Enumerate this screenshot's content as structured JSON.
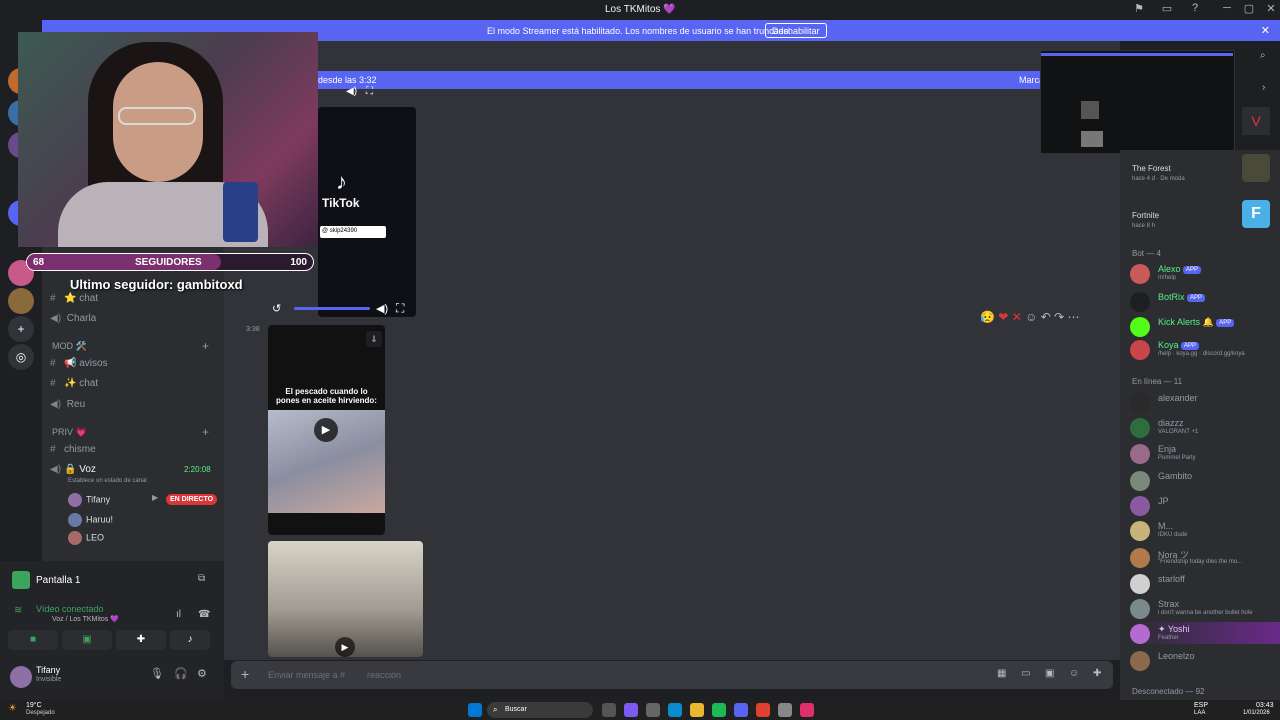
{
  "window": {
    "title": "Los TKMitos 💜"
  },
  "banner": {
    "text": "El modo Streamer está habilitado. Los nombres de usuario se han truncado.",
    "button": "Deshabilitar"
  },
  "stream_overlay": {
    "followers_current": "68",
    "followers_label": "SEGUIDORES",
    "followers_goal": "100",
    "followers_progress": 0.68,
    "last_follower": "Ultimo seguidor: gambitoxd"
  },
  "channels": {
    "items": [
      {
        "label": "chat"
      },
      {
        "label": "Charla"
      }
    ],
    "mod_category": "MOD 🛠️",
    "mod_items": [
      {
        "label": "avisos"
      },
      {
        "label": "chat"
      },
      {
        "label": "Reu"
      }
    ],
    "priv_category": "PRIV 💗",
    "priv_items": [
      {
        "label": "chisme"
      }
    ],
    "voice_channel": "Voz",
    "voice_timer": "2:20:08",
    "voice_status_hint": "Establece un estado de canal",
    "voice_users": [
      {
        "name": "Tifany"
      },
      {
        "name": "Haruu!"
      },
      {
        "name": "LEO"
      }
    ],
    "live_badge": "EN DIRECTO"
  },
  "voice_panel": {
    "screen_title": "Pantalla 1",
    "connected_label": "Vídeo conectado",
    "connected_sub": "Voz / Los TKMitos 💜",
    "user_name": "Tifany",
    "user_status": "Invisible"
  },
  "chat": {
    "new_messages": "desde las 3:32",
    "mark_read": "Marca",
    "timestamp": "3:38",
    "tiktok_brand": "TikTok",
    "tiktok_handle": "@ skip24390",
    "video_caption": "El pescado cuando lo pones en aceite hirviendo:",
    "composer_placeholder": "Enviar mensaje a #",
    "composer_suffix": "reacción"
  },
  "members": {
    "activity": [
      {
        "name": "The Forest",
        "sub": "hace 4 d · De moda"
      },
      {
        "name": "Fortnite",
        "sub": "hace 8 h"
      }
    ],
    "bot_header": "Bot — 4",
    "bots": [
      {
        "name": "Alexo",
        "sub": "m!help",
        "color": "#57f287"
      },
      {
        "name": "BotRix",
        "sub": "",
        "color": "#57f287"
      },
      {
        "name": "Kick Alerts",
        "sub": "",
        "color": "#57f287"
      },
      {
        "name": "Koya",
        "sub": "/help · koya.gg · discord.gg/koya",
        "color": "#57f287"
      }
    ],
    "app_tag": "APP",
    "online_header": "En línea — 11",
    "online": [
      {
        "name": "alexander",
        "sub": ""
      },
      {
        "name": "diazzz",
        "sub": "VALORANT +1"
      },
      {
        "name": "Enja",
        "sub": "Pummel Party"
      },
      {
        "name": "Gambito",
        "sub": ""
      },
      {
        "name": "JP",
        "sub": ""
      },
      {
        "name": "M...",
        "sub": "IDKU dude"
      },
      {
        "name": "Nora ツ",
        "sub": "\"Friendship today dies the mo..."
      },
      {
        "name": "starloff",
        "sub": ""
      },
      {
        "name": "Strax",
        "sub": "i don't wanna be another bullet hole"
      },
      {
        "name": "✦ Yoshi",
        "sub": "Feather"
      },
      {
        "name": "Leonelzo",
        "sub": ""
      }
    ],
    "offline_header": "Desconectado — 92"
  },
  "taskbar": {
    "weather_temp": "19°C",
    "weather_desc": "Despejado",
    "search_label": "Buscar",
    "lang": "ESP",
    "lang_sub": "LAA",
    "time": "03:43",
    "date": "1/01/2026"
  }
}
